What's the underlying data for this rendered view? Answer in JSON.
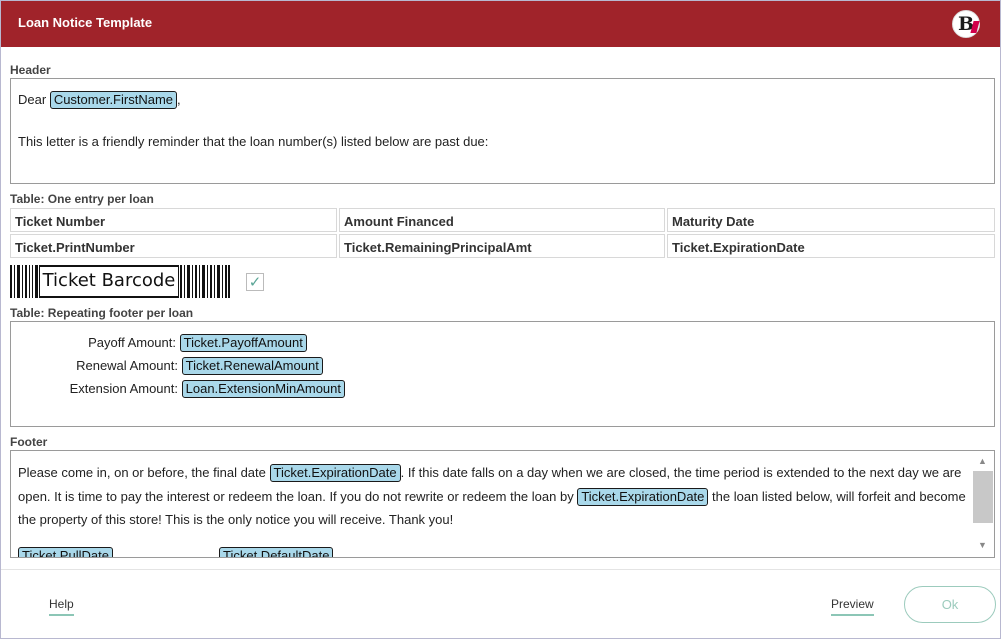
{
  "window": {
    "title": "Loan Notice Template",
    "logo_letter": "B"
  },
  "header_section": {
    "label": "Header",
    "greeting_prefix": "Dear",
    "greeting_token": "Customer.FirstName",
    "greeting_suffix": ",",
    "body_line": "This letter is a friendly reminder that the loan number(s) listed below are past due:"
  },
  "table_section": {
    "label": "Table: One entry per loan",
    "columns": [
      "Ticket Number",
      "Amount Financed",
      "Maturity Date"
    ],
    "fields": [
      "Ticket.PrintNumber",
      "Ticket.RemainingPrincipalAmt",
      "Ticket.ExpirationDate"
    ],
    "barcode_text": "Ticket Barcode",
    "barcode_checked": true
  },
  "repeating_footer": {
    "label": "Table: Repeating footer per loan",
    "rows": [
      {
        "label": "Payoff Amount:",
        "token": "Ticket.PayoffAmount"
      },
      {
        "label": "Renewal Amount:",
        "token": "Ticket.RenewalAmount"
      },
      {
        "label": "Extension Amount:",
        "token": "Loan.ExtensionMinAmount"
      }
    ]
  },
  "footer_section": {
    "label": "Footer",
    "text_1": "Please come in, on or before, the final date",
    "token_1": "Ticket.ExpirationDate",
    "text_2": ". If this date falls on a day when we are closed, the time period is extended to the next day we are open. It is time to pay the interest or redeem the loan. If you do not rewrite or redeem the loan by",
    "token_2": "Ticket.ExpirationDate",
    "text_3": "the loan listed below, will forfeit and become the property of this store! This is the only notice you will receive. Thank you!",
    "token_3": "Ticket.PullDate",
    "token_4": "Ticket.DefaultDate"
  },
  "actions": {
    "help_label": "Help",
    "preview_label": "Preview",
    "ok_label": "Ok"
  },
  "colors": {
    "titlebar": "#a0232a",
    "token_bg": "#a9d8ea",
    "accent": "#8cc6b6"
  }
}
